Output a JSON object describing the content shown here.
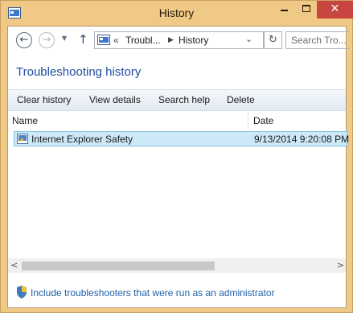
{
  "window": {
    "title": "History"
  },
  "titlebar": {
    "close_glyph": "✕"
  },
  "nav": {
    "breadcrumb_prefix": "«",
    "breadcrumb_1": "Troubl...",
    "breadcrumb_2": "History",
    "search_placeholder": "Search Tro..."
  },
  "heading": "Troubleshooting history",
  "toolbar": {
    "clear_history": "Clear history",
    "view_details": "View details",
    "search_help": "Search help",
    "delete": "Delete"
  },
  "table": {
    "columns": [
      "Name",
      "Date"
    ],
    "rows": [
      {
        "name": "Internet Explorer Safety",
        "date": "9/13/2014 9:20:08 PM"
      }
    ]
  },
  "footer": {
    "admin_link": "Include troubleshooters that were run as an administrator"
  },
  "icons": {
    "app": "control-panel-icon",
    "back": "back-arrow-icon",
    "forward": "forward-arrow-icon",
    "up": "up-arrow-icon",
    "refresh": "refresh-icon",
    "shield": "uac-shield-icon"
  },
  "colors": {
    "accent": "#1e4fa0",
    "selection": "#cde8f7",
    "frame": "#f0c987",
    "close": "#c84640"
  }
}
